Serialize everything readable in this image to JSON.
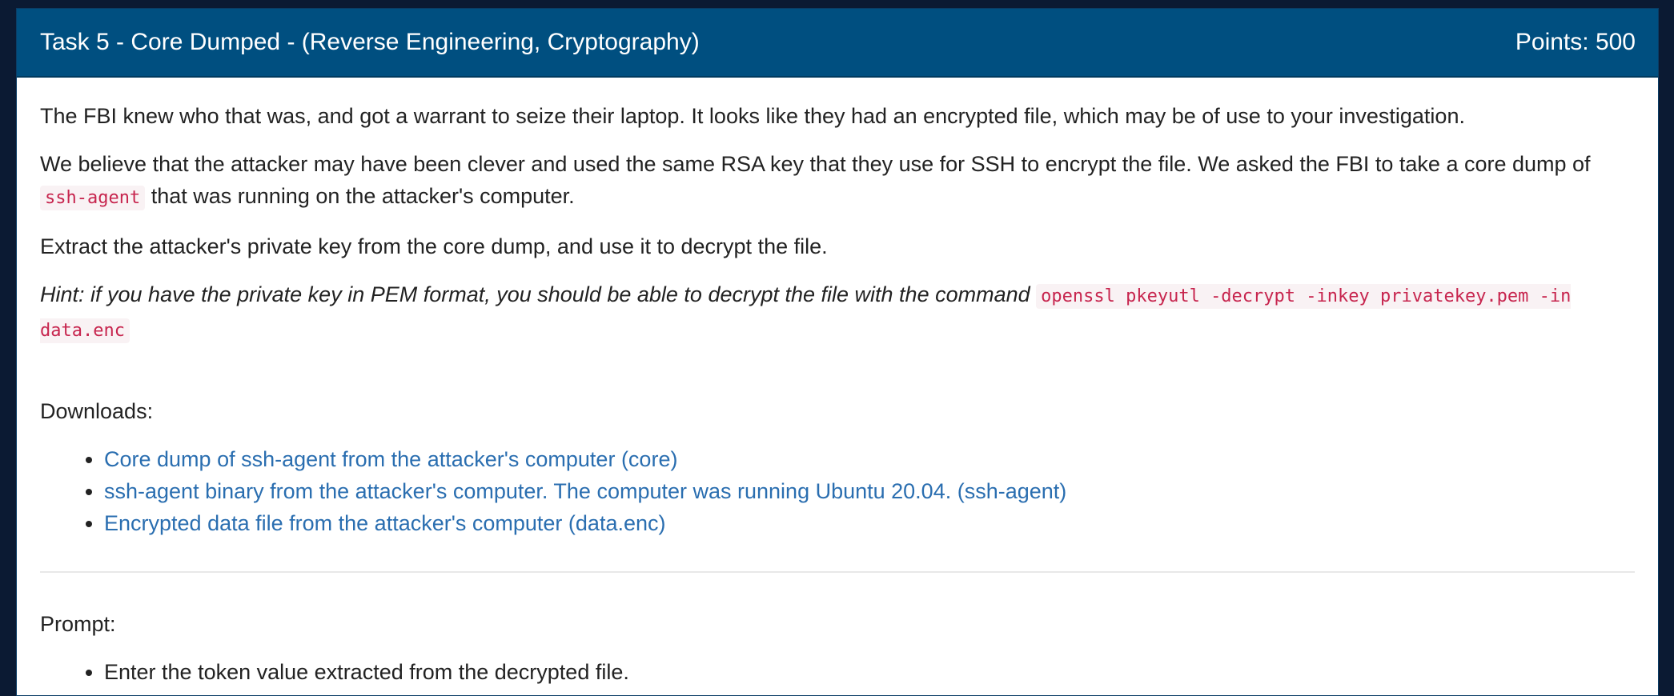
{
  "task": {
    "title": "Task 5 - Core Dumped - (Reverse Engineering, Cryptography)",
    "points": "Points: 500"
  },
  "body": {
    "p1": "The FBI knew who that was, and got a warrant to seize their laptop. It looks like they had an encrypted file, which may be of use to your investigation.",
    "p2_before": "We believe that the attacker may have been clever and used the same RSA key that they use for SSH to encrypt the file. We asked the FBI to take a core dump of ",
    "p2_code": "ssh-agent",
    "p2_after": " that was running on the attacker's computer.",
    "p3": "Extract the attacker's private key from the core dump, and use it to decrypt the file.",
    "hint_text": "Hint: if you have the private key in PEM format, you should be able to decrypt the file with the command ",
    "hint_code": "openssl pkeyutl -decrypt -inkey privatekey.pem -in data.enc"
  },
  "downloads": {
    "label": "Downloads:",
    "items": [
      {
        "label": "Core dump of ssh-agent from the attacker's computer (core)"
      },
      {
        "label": "ssh-agent binary from the attacker's computer. The computer was running Ubuntu 20.04. (ssh-agent)"
      },
      {
        "label": "Encrypted data file from the attacker's computer (data.enc)"
      }
    ]
  },
  "prompt": {
    "label": "Prompt:",
    "items": [
      {
        "label": "Enter the token value extracted from the decrypted file."
      }
    ]
  },
  "colors": {
    "header_bg": "#004f80",
    "link": "#2a6eb0",
    "code_text": "#c7254e",
    "code_bg": "#f9f2f4",
    "page_bg": "#0b1a33"
  }
}
